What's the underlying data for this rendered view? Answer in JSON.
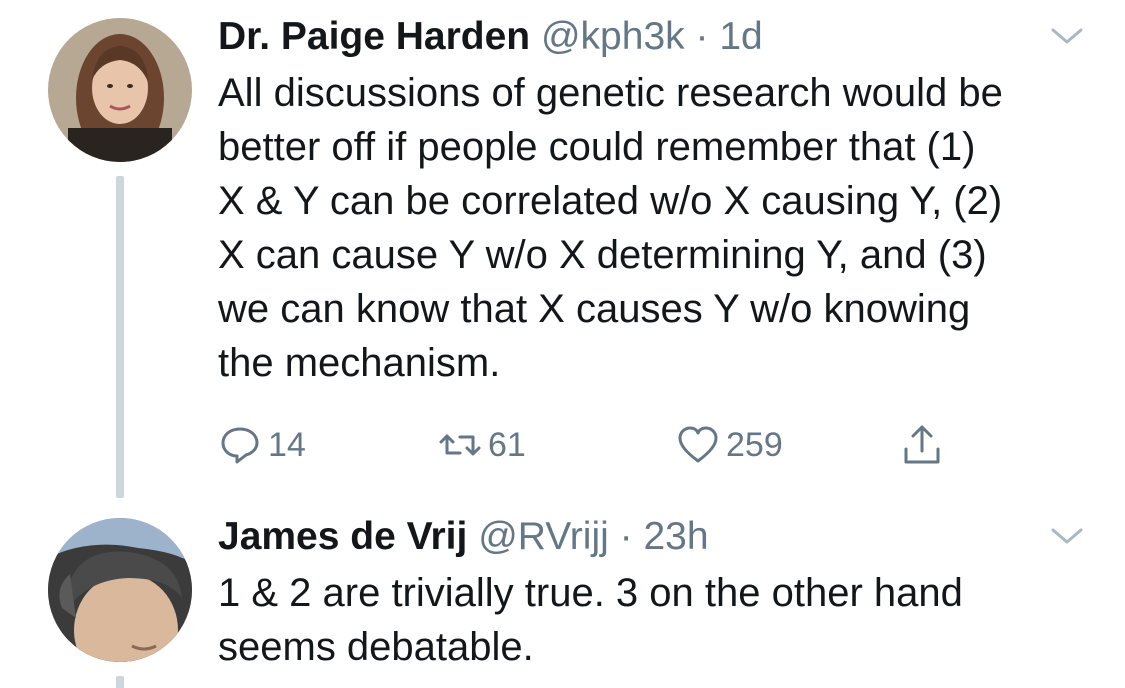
{
  "tweets": [
    {
      "name": "Dr. Paige Harden",
      "handle": "@kph3k",
      "separator": "·",
      "time": "1d",
      "text": "All discussions of genetic research would be\nbetter off if people could remember that (1)\nX & Y can be correlated w/o X causing Y, (2)\nX can cause Y w/o X determining Y, and (3)\nwe can know that X causes Y w/o knowing\nthe mechanism.",
      "actions": {
        "replies": "14",
        "retweets": "61",
        "likes": "259"
      }
    },
    {
      "name": "James de Vrij",
      "handle": "@RVrijj",
      "separator": "·",
      "time": "23h",
      "text": "1 & 2 are trivially true. 3 on the other hand\nseems debatable."
    }
  ],
  "icons": {
    "menu": "chevron-down-icon",
    "reply": "reply-icon",
    "retweet": "retweet-icon",
    "like": "heart-icon",
    "share": "share-icon"
  },
  "colors": {
    "text": "#14171a",
    "secondary": "#657786",
    "thread_line": "#ccd6dd",
    "chevron": "#aab8c2"
  }
}
